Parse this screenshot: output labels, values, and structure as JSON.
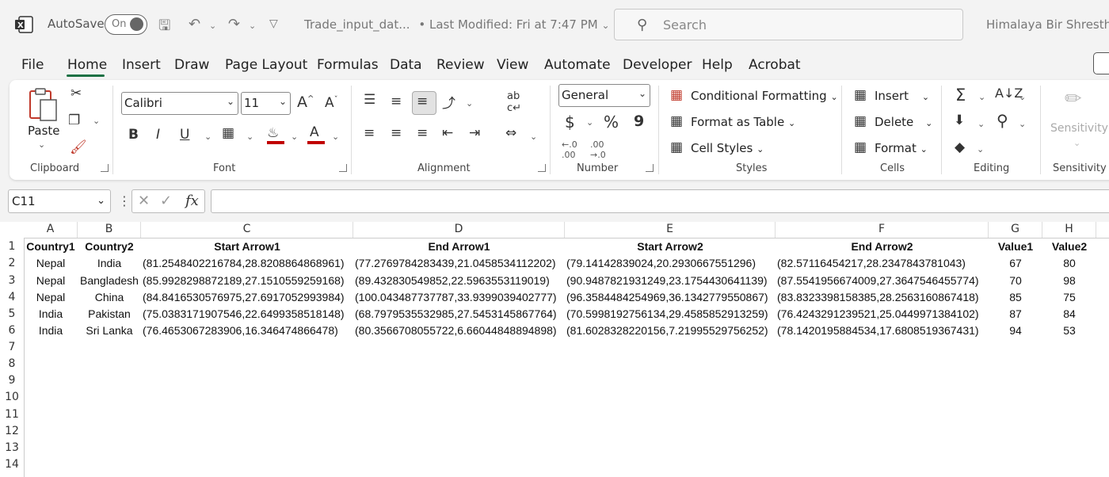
{
  "titlebar": {
    "autosave_label": "AutoSave",
    "autosave_state": "On",
    "doc_title": "Trade_input_dat...",
    "last_modified": "• Last Modified: Fri at 7:47 PM",
    "search_placeholder": "Search",
    "user_name": "Himalaya Bir Shrestha"
  },
  "menu": {
    "tabs": [
      "File",
      "Home",
      "Insert",
      "Draw",
      "Page Layout",
      "Formulas",
      "Data",
      "Review",
      "View",
      "Automate",
      "Developer",
      "Help",
      "Acrobat"
    ],
    "active": "Home"
  },
  "ribbon": {
    "clipboard": {
      "paste": "Paste",
      "label": "Clipboard"
    },
    "font": {
      "name": "Calibri",
      "size": "11",
      "label": "Font",
      "bold": "B",
      "italic": "I",
      "underline": "U"
    },
    "alignment": {
      "label": "Alignment"
    },
    "number": {
      "format": "General",
      "label": "Number",
      "currency": "$",
      "percent": "%",
      "comma": "9"
    },
    "styles": {
      "conditional": "Conditional Formatting",
      "format_table": "Format as Table",
      "cell_styles": "Cell Styles",
      "label": "Styles"
    },
    "cells": {
      "insert": "Insert",
      "delete": "Delete",
      "format": "Format",
      "label": "Cells"
    },
    "editing": {
      "label": "Editing"
    },
    "sensitivity": {
      "button": "Sensitivity",
      "label": "Sensitivity"
    }
  },
  "formula_bar": {
    "name_box": "C11",
    "fx": "fx",
    "value": ""
  },
  "sheet": {
    "columns": [
      "A",
      "B",
      "C",
      "D",
      "E",
      "F",
      "G",
      "H"
    ],
    "rows": [
      "1",
      "2",
      "3",
      "4",
      "5",
      "6",
      "7",
      "8",
      "9",
      "10",
      "11",
      "12",
      "13",
      "14"
    ],
    "header": [
      "Country1",
      "Country2",
      "Start Arrow1",
      "End Arrow1",
      "Start Arrow2",
      "End Arrow2",
      "Value1",
      "Value2"
    ],
    "data": [
      [
        "Nepal",
        "India",
        "(81.2548402216784,28.8208864868961)",
        "(77.2769784283439,21.0458534112202)",
        "(79.14142839024,20.2930667551296)",
        "(82.57116454217,28.2347843781043)",
        "67",
        "80"
      ],
      [
        "Nepal",
        "Bangladesh",
        "(85.9928298872189,27.1510559259168)",
        "(89.432830549852,22.5963553119019)",
        "(90.9487821931249,23.1754430641139)",
        "(87.5541956674009,27.3647546455774)",
        "70",
        "98"
      ],
      [
        "Nepal",
        "China",
        "(84.8416530576975,27.6917052993984)",
        "(100.043487737787,33.9399039402777)",
        "(96.3584484254969,36.1342779550867)",
        "(83.8323398158385,28.2563160867418)",
        "85",
        "75"
      ],
      [
        "India",
        "Pakistan",
        "(75.0383171907546,22.6499358518148)",
        "(68.7979535532985,27.5453145867764)",
        "(70.5998192756134,29.4585852913259)",
        "(76.4243291239521,25.0449971384102)",
        "87",
        "84"
      ],
      [
        "India",
        "Sri Lanka",
        "(76.4653067283906,16.346474866478)",
        "(80.3566708055722,6.66044848894898)",
        "(81.6028328220156,7.21995529756252)",
        "(78.1420195884534,17.6808519367431)",
        "94",
        "53"
      ]
    ]
  },
  "colors": {
    "excel_green": "#1e7145",
    "red": "#c00000"
  }
}
